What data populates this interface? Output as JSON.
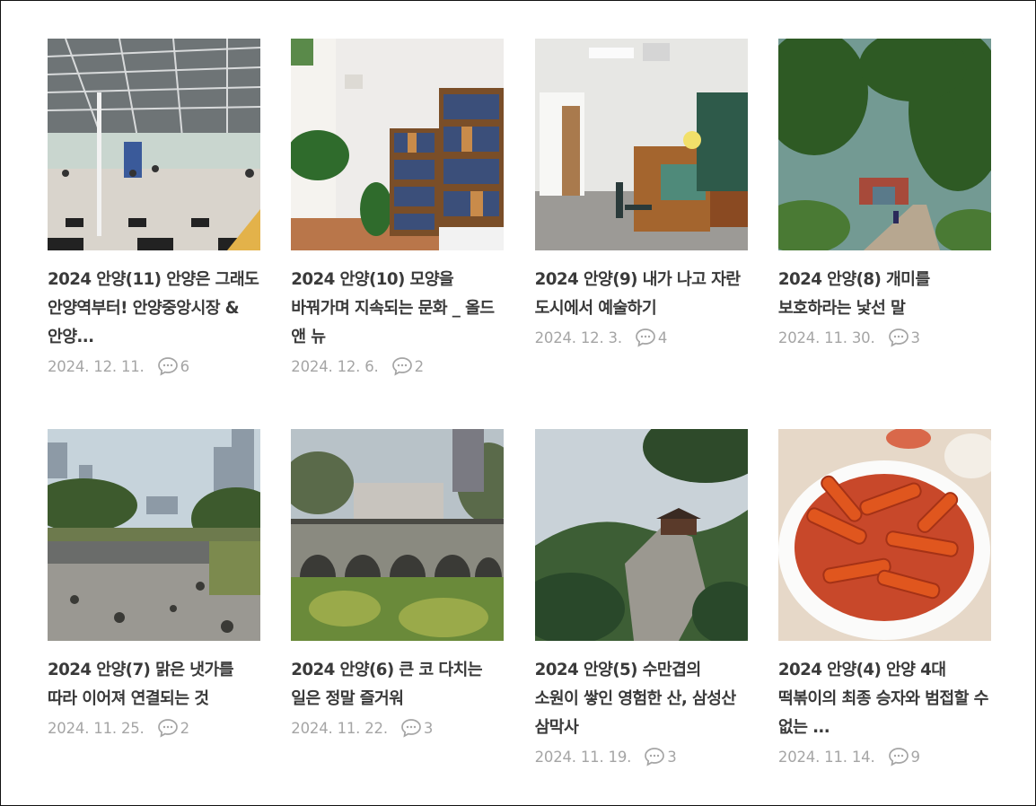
{
  "posts": [
    {
      "title": "2024 안양(11) 안양은 그래도 안양역부터! 안양중앙시장 & 안양...",
      "date": "2024. 12. 11.",
      "comments": "6",
      "thumb": "station-photo"
    },
    {
      "title": "2024 안양(10) 모양을 바꿔가며 지속되는 문화 _ 올드 앤 뉴",
      "date": "2024. 12. 6.",
      "comments": "2",
      "thumb": "bookshelf-photo"
    },
    {
      "title": "2024 안양(9) 내가 나고 자란 도시에서 예술하기",
      "date": "2024. 12. 3.",
      "comments": "4",
      "thumb": "studio-photo"
    },
    {
      "title": "2024 안양(8) 개미를 보호하라는 낯선 말",
      "date": "2024. 11. 30.",
      "comments": "3",
      "thumb": "park-path-photo"
    },
    {
      "title": "2024 안양(7) 맑은 냇가를 따라 이어져 연결되는 것",
      "date": "2024. 11. 25.",
      "comments": "2",
      "thumb": "stream-photo"
    },
    {
      "title": "2024 안양(6) 큰 코 다치는 일은 정말 즐거워",
      "date": "2024. 11. 22.",
      "comments": "3",
      "thumb": "stone-bridge-photo"
    },
    {
      "title": "2024 안양(5) 수만겹의 소원이 쌓인 영험한 산, 삼성산 삼막사",
      "date": "2024. 11. 19.",
      "comments": "3",
      "thumb": "mountain-rock-photo"
    },
    {
      "title": "2024 안양(4) 안양 4대 떡볶이의 최종 승자와 범접할 수 없는 ...",
      "date": "2024. 11. 14.",
      "comments": "9",
      "thumb": "tteokbokki-photo"
    }
  ]
}
